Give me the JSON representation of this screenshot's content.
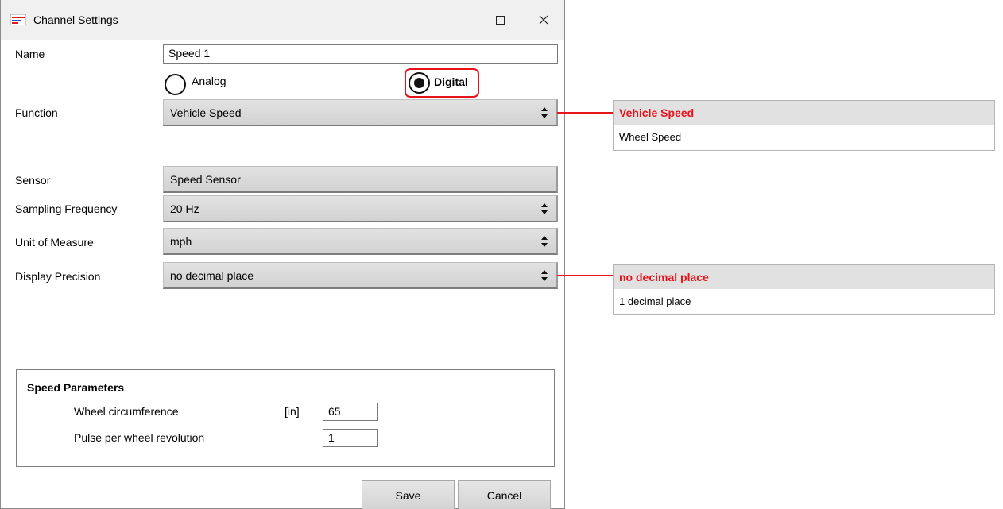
{
  "window": {
    "title": "Channel Settings",
    "minimize_symbol": "—",
    "maximize_symbol": "☐",
    "close_symbol": "✕"
  },
  "form": {
    "name_label": "Name",
    "name_value": "Speed 1",
    "radio_analog_label": "Analog",
    "radio_digital_label": "Digital",
    "selected_mode": "Digital",
    "function_label": "Function",
    "function_value": "Vehicle Speed",
    "sensor_label": "Sensor",
    "sensor_value": "Speed Sensor",
    "sampling_label": "Sampling Frequency",
    "sampling_value": "20 Hz",
    "unit_label": "Unit of Measure",
    "unit_value": "mph",
    "precision_label": "Display Precision",
    "precision_value": "no decimal place"
  },
  "speed_parameters": {
    "title": "Speed Parameters",
    "circumference_label": "Wheel circumference",
    "circumference_unit": "[in]",
    "circumference_value": "65",
    "pulse_label": "Pulse per wheel revolution",
    "pulse_value": "1"
  },
  "buttons": {
    "save": "Save",
    "cancel": "Cancel"
  },
  "function_dropdown": {
    "selected": "Vehicle Speed",
    "options": [
      "Wheel Speed"
    ]
  },
  "precision_dropdown": {
    "selected": "no decimal place",
    "options": [
      "1 decimal place"
    ]
  },
  "colors": {
    "highlight": "#e8141c",
    "selected_row_bg": "#e1e1e1"
  }
}
